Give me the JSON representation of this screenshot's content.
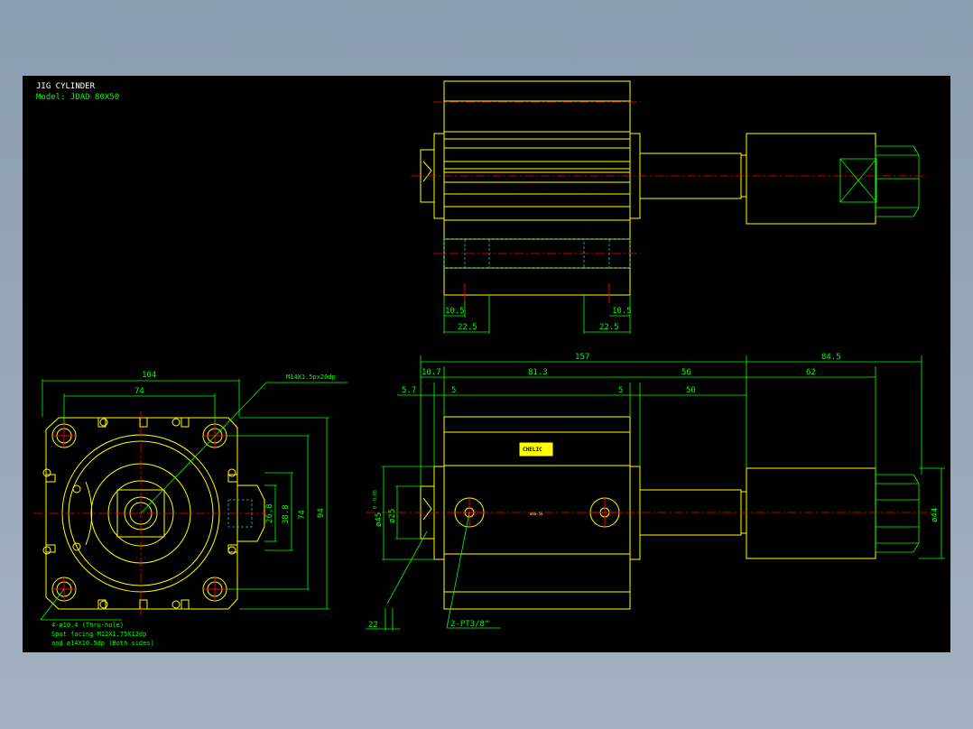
{
  "title": "JIG CYLINDER",
  "model": "Model: JDAD 80X50",
  "dims": {
    "top_left_a": "10.5",
    "top_left_b": "22.5",
    "top_right_a": "10.5",
    "top_right_b": "22.5",
    "front_w104": "104",
    "front_w74": "74",
    "front_port": "M14X1.5px20dp",
    "front_h268": "26.8",
    "front_h388": "38.8",
    "front_h74": "74",
    "front_h94": "94",
    "side_157": "157",
    "side_845": "84.5",
    "side_107": "10.7",
    "side_813": "81.3",
    "side_56": "56",
    "side_62": "62",
    "side_57": "5.7",
    "side_5a": "5",
    "side_5b": "5",
    "side_50": "50",
    "side_d45": "ø45",
    "side_d45tol": "0 -0.05",
    "side_d25": "ø25",
    "side_d44": "ø44",
    "side_22": "22",
    "side_pt": "2-PT3/8\""
  },
  "notes": {
    "line1": "4-ø10.4 (Thru-hole)",
    "line2": "Spot facing  M12X1.75X12dp",
    "line3": "and ø14X10.5dp (Both sides)"
  },
  "label_plate": "CHELIC",
  "colors": {
    "outline": "#ffff00",
    "dimension": "#00ff00",
    "centerline": "#ff0000",
    "hidden": "#00cccc",
    "background": "#000000"
  }
}
